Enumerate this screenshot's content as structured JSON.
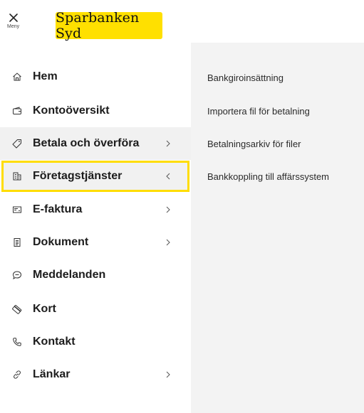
{
  "header": {
    "menu_label": "Meny",
    "logo_text": "Sparbanken Syd",
    "brand_color": "#ffe000"
  },
  "sidebar": {
    "items": [
      {
        "label": "Hem",
        "icon": "home-icon"
      },
      {
        "label": "Kontoöversikt",
        "icon": "wallet-icon"
      },
      {
        "label": "Betala och överföra",
        "icon": "tag-icon",
        "has_submenu": true,
        "selected": true
      },
      {
        "label": "Företagstjänster",
        "icon": "building-icon",
        "has_submenu": true,
        "expanded": true,
        "focused": true
      },
      {
        "label": "E-faktura",
        "icon": "invoice-card-icon",
        "has_submenu": true
      },
      {
        "label": "Dokument",
        "icon": "document-icon",
        "has_submenu": true
      },
      {
        "label": "Meddelanden",
        "icon": "chat-bubble-icon"
      },
      {
        "label": "Kort",
        "icon": "card-icon"
      },
      {
        "label": "Kontakt",
        "icon": "phone-icon"
      },
      {
        "label": "Länkar",
        "icon": "link-icon",
        "has_submenu": true
      }
    ]
  },
  "submenu": {
    "items": [
      "Bankgiroinsättning",
      "Importera fil för betalning",
      "Betalningsarkiv för filer",
      "Bankkoppling till affärssystem"
    ]
  },
  "colors": {
    "page_background": "#e3f0f7",
    "highlight_outline": "#ffdd00",
    "submenu_background": "#f3f3f3"
  }
}
